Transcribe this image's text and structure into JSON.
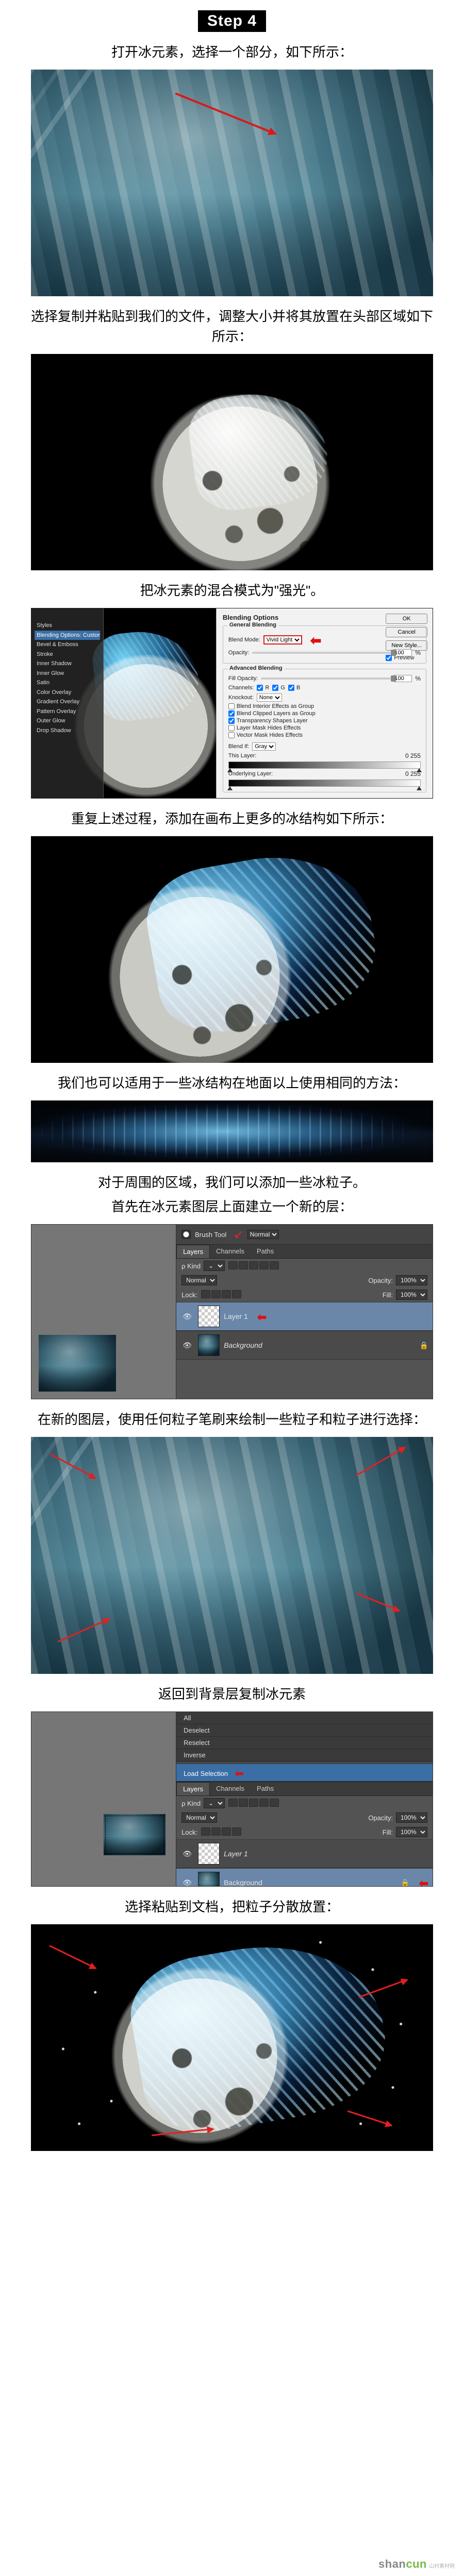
{
  "step_label": "Step 4",
  "captions": {
    "c1": "打开冰元素，选择一个部分，如下所示：",
    "c2": "选择复制并粘贴到我们的文件，调整大小并将其放置在头部区域如下所示：",
    "c3": "把冰元素的混合模式为\"强光\"。",
    "c4": "重复上述过程，添加在画布上更多的冰结构如下所示：",
    "c5": "我们也可以适用于一些冰结构在地面以上使用相同的方法：",
    "c6a": "对于周围的区域，我们可以添加一些冰粒子。",
    "c6b": "首先在冰元素图层上面建立一个新的层：",
    "c7": "在新的图层，使用任何粒子笔刷来绘制一些粒子和粒子进行选择：",
    "c8": "返回到背景层复制冰元素",
    "c9": "选择粘贴到文档，把粒子分散放置："
  },
  "tool_context": {
    "items": [
      "Bevel & Emboss",
      "Stroke",
      "Inner Shadow",
      "Inner Glow",
      "Satin",
      "Color Overlay",
      "Gradient Overlay",
      "Pattern Overlay",
      "Outer Glow",
      "Drop Shadow"
    ],
    "header": "Styles",
    "selected": "Blending Options: Custom"
  },
  "blending_dialog": {
    "title": "Blending Options",
    "section_general": "General Blending",
    "blend_mode_label": "Blend Mode:",
    "blend_mode_value": "Vivid Light",
    "opacity_label": "Opacity:",
    "opacity_value": "100",
    "section_advanced": "Advanced Blending",
    "fill_label": "Fill Opacity:",
    "fill_value": "100",
    "channels_label": "Channels:",
    "ch_r": "R",
    "ch_g": "G",
    "ch_b": "B",
    "knockout_label": "Knockout:",
    "knockout_value": "None",
    "cb1": "Blend Interior Effects as Group",
    "cb2": "Blend Clipped Layers as Group",
    "cb3": "Transparency Shapes Layer",
    "cb4": "Layer Mask Hides Effects",
    "cb5": "Vector Mask Hides Effects",
    "blendif_label": "Blend If:",
    "blendif_value": "Gray",
    "this_layer": "This Layer:",
    "this_range": "0     255",
    "under_layer": "Underlying Layer:",
    "under_range": "0     255",
    "btn_ok": "OK",
    "btn_cancel": "Cancel",
    "btn_new": "New Style...",
    "btn_preview": "Preview"
  },
  "layers_panel1": {
    "brush_label": "Brush Tool",
    "brush_mode": "Normal",
    "tabs": {
      "layers": "Layers",
      "channels": "Channels",
      "paths": "Paths"
    },
    "kind_label": "ρ Kind",
    "mode": "Normal",
    "opacity_label": "Opacity:",
    "opacity_value": "100%",
    "lock_label": "Lock:",
    "fill_label": "Fill:",
    "fill_value": "100%",
    "layer1": "Layer 1",
    "background": "Background"
  },
  "layers_panel2": {
    "menu_items": [
      "All",
      "Deselect",
      "Reselect",
      "Inverse"
    ],
    "load_selection": "Load Selection",
    "tabs": {
      "layers": "Layers",
      "channels": "Channels",
      "paths": "Paths"
    },
    "kind_label": "ρ Kind",
    "mode": "Normal",
    "opacity_label": "Opacity:",
    "opacity_value": "100%",
    "lock_label": "Lock:",
    "fill_label": "Fill:",
    "fill_value": "100%",
    "layer1": "Layer 1",
    "background": "Background"
  },
  "watermark": {
    "brand_a": "shan",
    "brand_b": "cun",
    "suffix": "山村素材网"
  }
}
